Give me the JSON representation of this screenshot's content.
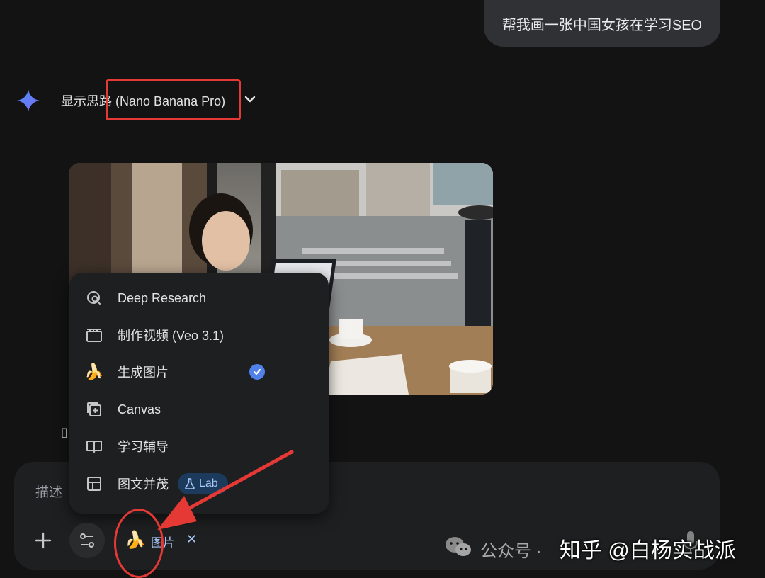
{
  "conversation": {
    "user_prompt": "帮我画一张中国女孩在学习SEO",
    "thinking_label": "显示思路 (Nano Banana Pro)"
  },
  "generated_image": {
    "description_hidden": ""
  },
  "tools_menu": {
    "items": [
      {
        "label": "Deep Research",
        "icon": "deep-research-icon"
      },
      {
        "label": "制作视频 (Veo 3.1)",
        "icon": "video-clapper-icon"
      },
      {
        "label": "生成图片",
        "icon": "banana-icon",
        "selected": true
      },
      {
        "label": "Canvas",
        "icon": "canvas-icon"
      },
      {
        "label": "学习辅导",
        "icon": "book-icon"
      },
      {
        "label": "图文并茂",
        "icon": "layout-icon",
        "badge": "Labs"
      }
    ],
    "labs_partial_text": "Lab"
  },
  "input": {
    "placeholder_partial": "描述",
    "chip_label": "图片",
    "chip_emoji": "🍌",
    "chip_close": "✕",
    "plus": "+"
  },
  "watermark": {
    "wechat": "公众号 ·",
    "zhihu": "知乎 @白杨实战派"
  },
  "colors": {
    "background": "#131314",
    "accent_blue": "#a8c7fa",
    "check_blue": "#4f81e8",
    "annotation_red": "#e53935"
  }
}
